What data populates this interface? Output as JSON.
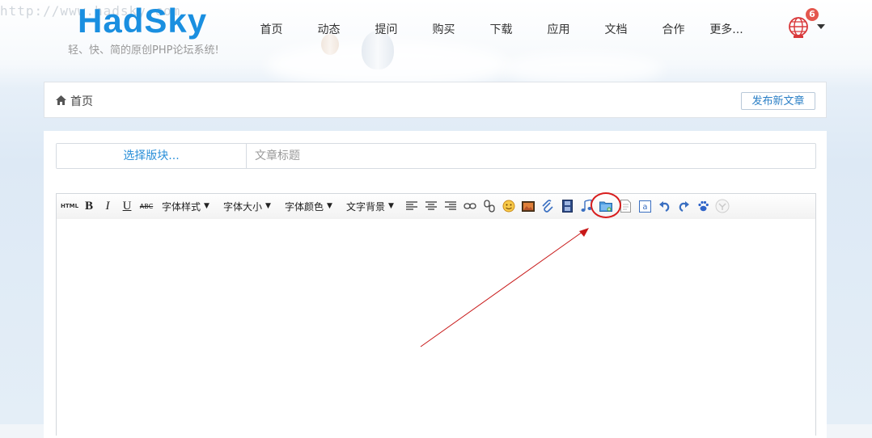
{
  "watermark": "http://www.hadsky.com",
  "brand": {
    "logo": "HadSky",
    "tagline": "轻、快、简的原创PHP论坛系统!"
  },
  "nav": [
    {
      "label": "首页"
    },
    {
      "label": "动态"
    },
    {
      "label": "提问"
    },
    {
      "label": "购买"
    },
    {
      "label": "下载"
    },
    {
      "label": "应用"
    },
    {
      "label": "文档"
    },
    {
      "label": "合作"
    },
    {
      "label": "更多..."
    }
  ],
  "notifications": {
    "count": "6",
    "icon": "globe-icon"
  },
  "breadcrumb": {
    "home_label": "首页",
    "home_icon": "home-icon"
  },
  "actions": {
    "publish_label": "发布新文章"
  },
  "form": {
    "board_select_label": "选择版块...",
    "title_placeholder": "文章标题"
  },
  "toolbar": {
    "dropdowns": [
      {
        "label": "字体样式"
      },
      {
        "label": "字体大小"
      },
      {
        "label": "字体颜色"
      },
      {
        "label": "文字背景"
      }
    ],
    "buttons": [
      "html-icon",
      "bold-icon",
      "italic-icon",
      "underline-icon",
      "strikethrough-icon",
      "align-left-icon",
      "align-center-icon",
      "align-right-icon",
      "link-icon",
      "unlink-icon",
      "emoji-icon",
      "image-icon",
      "attachment-icon",
      "video-icon",
      "music-icon",
      "folder-upload-icon",
      "file-icon",
      "code-icon",
      "undo-icon",
      "redo-icon",
      "paw-icon",
      "circle-icon"
    ],
    "text_glyphs": {
      "html": "HTML",
      "bold": "B",
      "italic": "I",
      "underline": "U",
      "strike": "ABC"
    }
  },
  "annotation": {
    "highlighted": "folder-upload-icon",
    "color": "#d81e1e"
  },
  "colors": {
    "accent": "#1a8fe0",
    "link": "#2a7fc6",
    "badge": "#e4574e"
  }
}
